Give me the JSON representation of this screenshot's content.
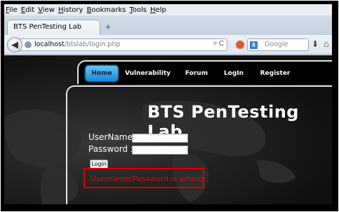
{
  "browser": {
    "menu": [
      "File",
      "Edit",
      "View",
      "History",
      "Bookmarks",
      "Tools",
      "Help"
    ],
    "tab_title": "BTS PenTesting Lab",
    "new_tab": "+",
    "url_host": "localhost",
    "url_path": "/btslab/login.php",
    "url_icons": "▿ C",
    "search_engine_letter": "8",
    "search_placeholder": "Google"
  },
  "site": {
    "nav": [
      "Home",
      "Vulnerability",
      "Forum",
      "LogIn",
      "Register"
    ],
    "title": "BTS PenTesting Lab",
    "form": {
      "username_label": "UserName:",
      "password_label": "Password :",
      "username_value": "",
      "password_value": "",
      "login_button": "Login"
    },
    "error": "Username/Password is wrong"
  },
  "colors": {
    "accent_nav": "#1a86d8",
    "error": "#d21010",
    "highlight_box": "#d80000"
  },
  "icons": [
    "back-arrow-icon",
    "globe-icon",
    "reload-icon",
    "duckduckgo-icon",
    "google-icon",
    "download-icon",
    "home-icon"
  ]
}
